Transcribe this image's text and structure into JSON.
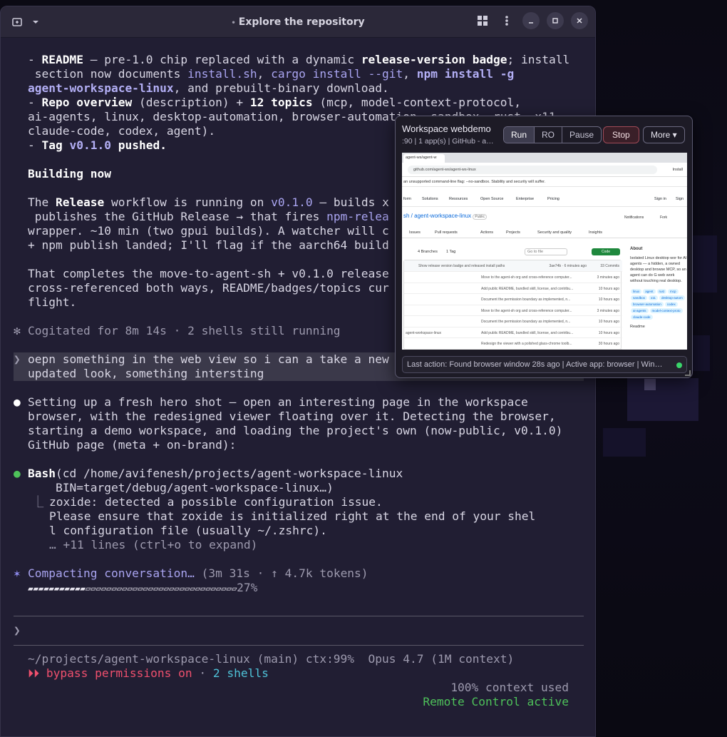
{
  "window": {
    "title": "Explore the repository",
    "title_dot": "•"
  },
  "titlebar_icons": {
    "new_tab": "new-tab-icon",
    "dropdown": "chevron-down-icon",
    "grid": "grid-icon",
    "menu": "kebab-menu-icon",
    "minimize": "minimize-icon",
    "restore": "restore-icon",
    "close": "close-icon"
  },
  "transcript": {
    "l1": {
      "a": "- ",
      "b1": "README",
      "c": " — pre-1.0 chip replaced with a dynamic ",
      "b2": "release-version badge",
      "d": "; install"
    },
    "l2": {
      "a": " section now documents ",
      "lk1": "install.sh",
      "b": ", ",
      "lk2": "cargo install --git",
      "c": ", ",
      "lk3": "npm install -g"
    },
    "l3": {
      "lk": "agent-workspace-linux",
      "a": ", and prebuilt-binary download."
    },
    "l4": {
      "a": "- ",
      "b1": "Repo overview",
      "c": " (description) + ",
      "b2": "12 topics",
      "d": " (mcp, model-context-protocol,"
    },
    "l5": "ai-agents, linux, desktop-automation, browser-automation, sandbox, rust, x11,",
    "l6": "claude-code, codex, agent).",
    "l7": {
      "a": "- ",
      "b1": "Tag ",
      "lk": "v0.1.0",
      "b2": " pushed."
    },
    "l8": "Building now",
    "l9": {
      "a": "The ",
      "b": "Release",
      "c": " workflow is running on ",
      "lk": "v0.1.0",
      "d": " — builds x"
    },
    "l10": {
      "a": " publishes the GitHub Release → that fires ",
      "lk": "npm-relea"
    },
    "l11": "wrapper. ~10 min (two gpui builds). A watcher will c",
    "l12": "+ npm publish landed; I'll flag if the aarch64 build",
    "l13": "That completes the move-to-agent-sh + v0.1.0 release",
    "l14": "cross-referenced both ways, README/badges/topics cur",
    "l15": "flight.",
    "cogitated_mark": "✻",
    "cogitated": "Cogitated for 8m 14s · 2 shells still running",
    "prompt_mark": "❯",
    "user_msg_1": "oepn something in the web view so i can a take a new",
    "user_msg_2": "updated look, something intersting",
    "bullet": "●",
    "reply_1": "Setting up a fresh hero shot — open an interesting page in the workspace",
    "reply_2": "browser, with the redesigned viewer floating over it. Detecting the browser,",
    "reply_3": "starting a demo workspace, and loading the project's own (now-public, v0.1.0)",
    "reply_4": "GitHub page (meta + on-brand):",
    "bash_label": "Bash",
    "bash_cmd_1": "(cd /home/avifenesh/projects/agent-workspace-linux",
    "bash_cmd_2": "    BIN=target/debug/agent-workspace-linux…)",
    "tree": "⎿",
    "out_1": "zoxide: detected a possible configuration issue.",
    "out_2": "Please ensure that zoxide is initialized right at the end of your shel",
    "out_3": "l configuration file (usually ~/.zshrc).",
    "out_4": "… +11 lines (ctrl+o to expand)",
    "compact_mark": "✶",
    "compact_label": "Compacting conversation…",
    "compact_meta": " (3m 31s · ↑ 4.7k tokens)",
    "progress_bar": "▰▰▰▰▰▰▰▰▰▰▰▱▱▱▱▱▱▱▱▱▱▱▱▱▱▱▱▱▱▱▱▱▱▱▱▱▱▱▱▱",
    "progress_pct": "27%",
    "progress_value": 0.27
  },
  "input": {
    "prompt": "❯",
    "value": ""
  },
  "statusline": {
    "path": "~/projects/agent-workspace-linux (main) ctx:99%  Opus 4.7 (1M context)",
    "bypass_mark": "⏵⏵",
    "bypass": " bypass permissions on",
    "sep": " · ",
    "shells": "2 shells",
    "context_used": "100% context used",
    "remote": "Remote Control active"
  },
  "viewer": {
    "title": "Workspace webdemo",
    "subtitle": ":90 | 1 app(s) | GitHub - a…",
    "modes": [
      "Run",
      "RO",
      "Pause"
    ],
    "active_mode": "Run",
    "stop": "Stop",
    "more": "More ▾",
    "status": "Last action: Found browser window 28s ago | Active app: browser | Win…",
    "status_color": "#3ad46a"
  },
  "screenshot": {
    "tab": "agent-ws/agent-w",
    "url": "github.com/agent-ws/agent-ws-linux",
    "install": "Install",
    "warning": "an unsupported command-line flag: --no-sandbox. Stability and security will suffer.",
    "nav": [
      "form",
      "Solutions",
      "Resources",
      "Open Source",
      "Enterprise",
      "Pricing"
    ],
    "sign_in": "Sign in",
    "sign_up": "Sign",
    "repo": "sh / agent-workspace-linux",
    "visibility": "Public",
    "notifications": "Notifications",
    "fork": "Fork",
    "tabs": [
      "Issues",
      "Pull requests",
      "Actions",
      "Projects",
      "Security and quality",
      "Insights"
    ],
    "branches": "4 Branches",
    "tags": "1 Tag",
    "goto": "Go to file",
    "code": "Code",
    "commit_msg": "Show release version badge and released install paths",
    "commit_hash": "3ae74b · 6 minutes ago",
    "commits": "33 Commits",
    "rows": [
      {
        "name": "",
        "msg": "Move to the agent-sh org and cross-reference computer...",
        "time": "3 minutes ago"
      },
      {
        "name": "",
        "msg": "Add public README, bundled skill, license, and contribu...",
        "time": "10 hours ago"
      },
      {
        "name": "",
        "msg": "Document the permission boundary as implemented, n...",
        "time": "10 hours ago"
      },
      {
        "name": "",
        "msg": "Move to the agent-sh org and cross-reference computer...",
        "time": "3 minutes ago"
      },
      {
        "name": "",
        "msg": "Document the permission boundary as implemented, n...",
        "time": "10 hours ago"
      },
      {
        "name": "agent-workspace-linux",
        "msg": "Add public README, bundled skill, license, and contribu...",
        "time": "10 hours ago"
      },
      {
        "name": "",
        "msg": "Redesign the viewer with a polished glass-chrome toolb...",
        "time": "30 hours ago"
      }
    ],
    "about_title": "About",
    "about_text": "Isolated Linux desktop wor for AI agents — a hidden, a owned desktop and browse MCP, so an agent can do G web work without touching real desktop.",
    "topics": [
      "linux",
      "agent",
      "rust",
      "mcp",
      "sandbox",
      "x11",
      "desktop-autom",
      "browser-automation",
      "codex",
      "ai-agents",
      "model-context-proto",
      "claude-code"
    ],
    "readme": "Readme"
  }
}
